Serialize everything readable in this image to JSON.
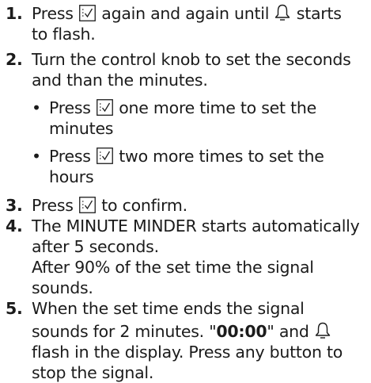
{
  "steps": [
    {
      "number": "1.",
      "parts": [
        "Press",
        "again and again until",
        "starts",
        "to flash."
      ]
    },
    {
      "number": "2.",
      "lines": [
        "Turn the control knob to set the seconds",
        "and than the minutes."
      ],
      "bullets": [
        {
          "symbol": "•",
          "press": "Press",
          "line1": "one more time to set the",
          "line2": "minutes"
        },
        {
          "symbol": "•",
          "press": "Press",
          "line1": "two more times to set the",
          "line2": "hours"
        }
      ]
    },
    {
      "number": "3.",
      "parts": [
        "Press",
        "to confirm."
      ]
    },
    {
      "number": "4.",
      "lines": [
        "The MINUTE MINDER starts automatically",
        "after 5 seconds.",
        "After 90% of the set time the signal",
        "sounds."
      ]
    },
    {
      "number": "5.",
      "line1": "When the set time ends the signal",
      "line2_a": "sounds for 2 minutes. \"",
      "line2_bold": "00:00",
      "line2_b": "\" and",
      "line3": "flash in the display. Press any button to",
      "line4": "stop the signal."
    }
  ],
  "icons": {
    "confirm": "confirm-checkbox-icon",
    "bell": "bell-icon"
  }
}
